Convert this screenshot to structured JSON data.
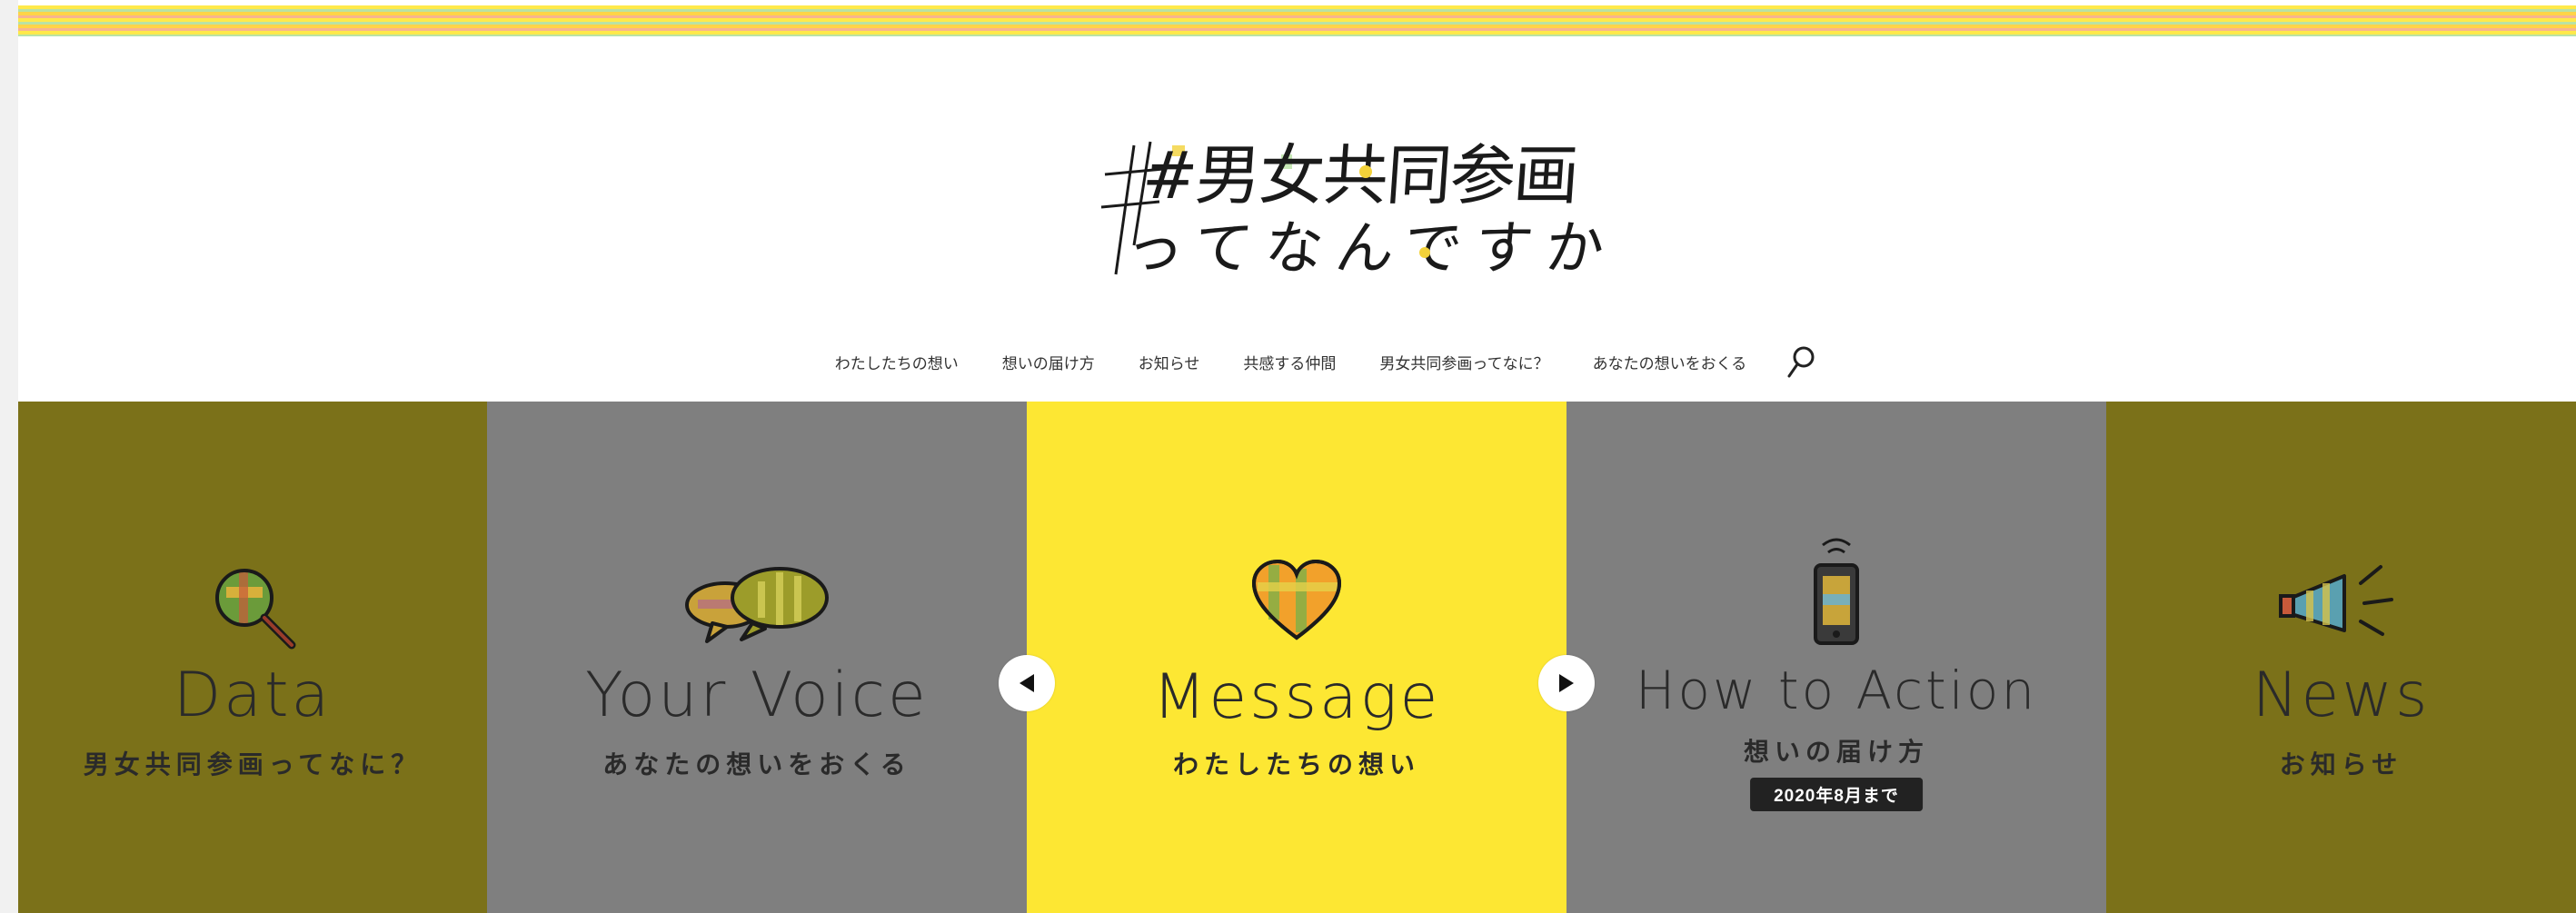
{
  "logo": {
    "line1": "#男女共同参画",
    "line2": "ってなんですか"
  },
  "nav": {
    "items": [
      "わたしたちの想い",
      "想いの届け方",
      "お知らせ",
      "共感する仲間",
      "男女共同参画ってなに？",
      "あなたの想いをおくる"
    ],
    "search_icon": "search-icon"
  },
  "slider": {
    "panels": [
      {
        "title": "Data",
        "subtitle": "男女共同参画ってなに？",
        "icon": "magnifier-icon",
        "color": "#7b7119"
      },
      {
        "title": "Your Voice",
        "subtitle": "あなたの想いをおくる",
        "icon": "speech-bubbles-icon",
        "color": "#7f7f7f"
      },
      {
        "title": "Message",
        "subtitle": "わたしたちの想い",
        "icon": "heart-icon",
        "color": "#fde733"
      },
      {
        "title": "How to Action",
        "subtitle": "想いの届け方",
        "badge": "2020年8月まで",
        "icon": "smartphone-icon",
        "color": "#7f7f7f"
      },
      {
        "title": "News",
        "subtitle": "お知らせ",
        "icon": "megaphone-icon",
        "color": "#7b7119"
      }
    ],
    "prev_icon": "prev-arrow-icon",
    "next_icon": "next-arrow-icon"
  },
  "colors": {
    "accent_yellow": "#fde733",
    "olive": "#7b7119",
    "gray": "#7f7f7f",
    "stripe_yellow": "#ffe94a",
    "stripe_green": "#b9e2a4",
    "stripe_orange": "#f7b58f"
  }
}
